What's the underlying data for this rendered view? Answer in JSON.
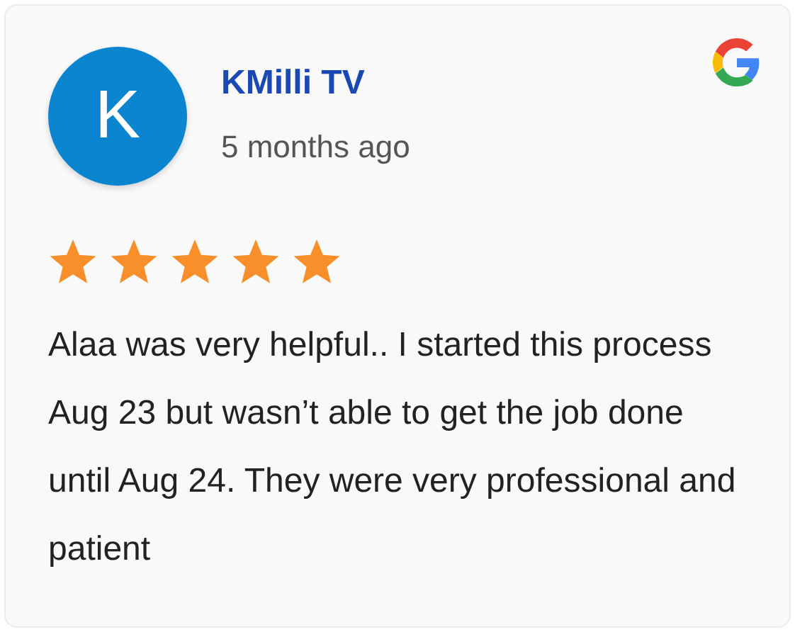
{
  "review": {
    "initial": "K",
    "author": "KMilli TV",
    "time": "5 months ago",
    "stars": 5,
    "text": "Alaa was very helpful.. I started this process Aug 23 but wasn’t able to get the job done until Aug 24. They were very professional and patient"
  }
}
